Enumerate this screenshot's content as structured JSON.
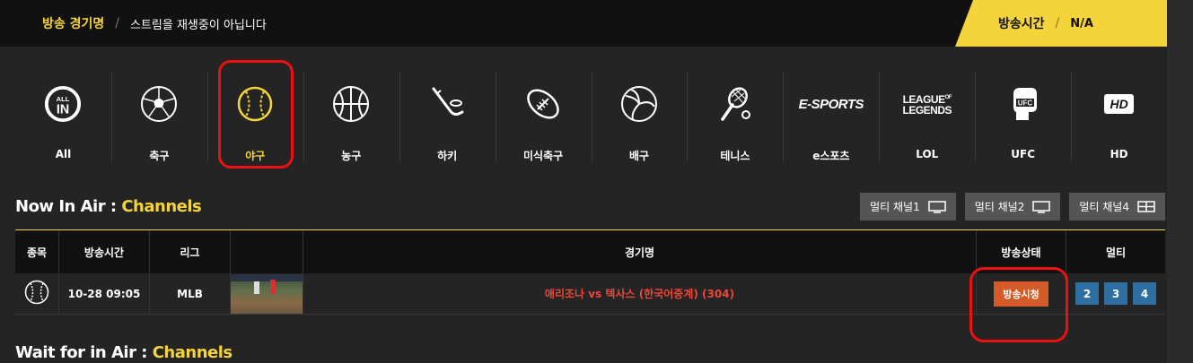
{
  "header": {
    "title": "방송 경기명",
    "separator": "/",
    "status_message": "스트림을 재생중이 아닙니다",
    "broadcast_time_label": "방송시간",
    "broadcast_time_value": "N/A"
  },
  "categories": [
    {
      "label": "All",
      "icon": "all-in-icon"
    },
    {
      "label": "축구",
      "icon": "soccer-ball-icon"
    },
    {
      "label": "야구",
      "icon": "baseball-icon",
      "active": true
    },
    {
      "label": "농구",
      "icon": "basketball-icon"
    },
    {
      "label": "하키",
      "icon": "hockey-icon"
    },
    {
      "label": "미식축구",
      "icon": "football-icon"
    },
    {
      "label": "배구",
      "icon": "volleyball-icon"
    },
    {
      "label": "테니스",
      "icon": "tennis-icon"
    },
    {
      "label": "e스포츠",
      "icon": "esports-icon",
      "icon_text": "E-SPORTS"
    },
    {
      "label": "LOL",
      "icon": "lol-icon",
      "icon_text_1": "LEAGUE",
      "icon_text_of": "OF",
      "icon_text_2": "LEGENDS"
    },
    {
      "label": "UFC",
      "icon": "ufc-glove-icon"
    },
    {
      "label": "HD",
      "icon": "hd-icon",
      "icon_text": "HD"
    }
  ],
  "now_in_air": {
    "title_prefix": "Now In Air : ",
    "title_highlight": "Channels"
  },
  "multi_buttons": [
    {
      "label": "멀티 채널1",
      "icon": "monitor-icon"
    },
    {
      "label": "멀티 채널2",
      "icon": "monitor-icon"
    },
    {
      "label": "멀티 채널4",
      "icon": "grid-monitor-icon"
    }
  ],
  "table": {
    "headers": [
      "종목",
      "방송시간",
      "리그",
      "",
      "경기명",
      "방송상태",
      "멀티"
    ],
    "rows": [
      {
        "sport_icon": "baseball-icon",
        "time": "10-28 09:05",
        "league": "MLB",
        "game": "애리조나 vs 텍사스 (한국어중계) (304)",
        "status": "방송시청",
        "multi": [
          "2",
          "3",
          "4"
        ]
      }
    ]
  },
  "wait_in_air": {
    "title_prefix": "Wait for in Air : ",
    "title_highlight": "Channels"
  },
  "colors": {
    "accent": "#f5d33a",
    "background": "#242424",
    "highlight_red": "#ee1111",
    "watch_button": "#d45a27",
    "multi_button": "#2e6fa3"
  }
}
